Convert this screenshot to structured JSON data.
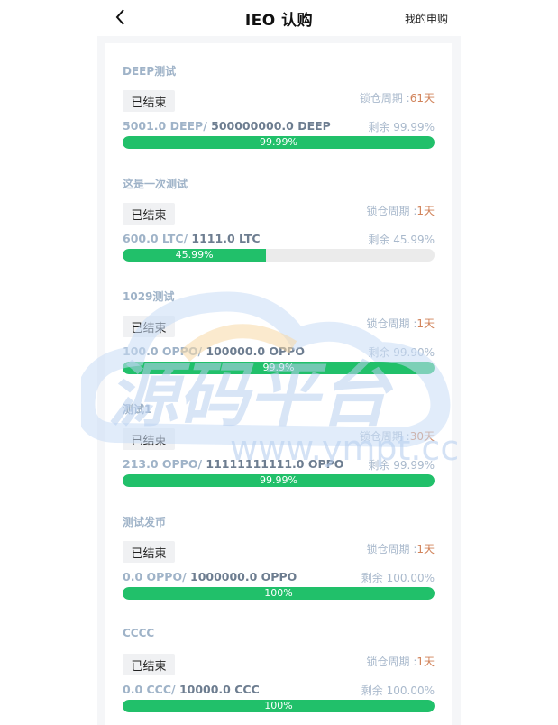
{
  "header": {
    "title": "IEO 认购",
    "my_apply": "我的申购"
  },
  "colors": {
    "progress": "#21c06a",
    "track": "#ebebeb",
    "lock_value": "#d1835a",
    "muted_text": "#9fb3c8"
  },
  "icons": {
    "back": "chevron-left-icon"
  },
  "watermark": {
    "text": "源码平台",
    "url": "www.ympt.cc"
  },
  "items": [
    {
      "name": "DEEP测试",
      "status": "已结束",
      "lock_label": "锁仓周期 :",
      "lock_value": "61天",
      "sold": "5001.0 DEEP/",
      "total": " 500000000.0 DEEP",
      "remain": "剩余 99.99%",
      "progress": 100,
      "progress_label": "99.99%"
    },
    {
      "name": "这是一次测试",
      "status": "已结束",
      "lock_label": "锁仓周期 :",
      "lock_value": "1天",
      "sold": "600.0 LTC/",
      "total": " 1111.0 LTC",
      "remain": "剩余 45.99%",
      "progress": 45.99,
      "progress_label": "45.99%"
    },
    {
      "name": "1029测试",
      "status": "已结束",
      "lock_label": "锁仓周期 :",
      "lock_value": "1天",
      "sold": "100.0 OPPO/",
      "total": " 100000.0 OPPO",
      "remain": "剩余 99.90%",
      "progress": 100,
      "progress_label": "99.9%"
    },
    {
      "name": "测试1",
      "status": "已结束",
      "lock_label": "锁仓周期 :",
      "lock_value": "30天",
      "sold": "213.0 OPPO/",
      "total": " 11111111111.0 OPPO",
      "remain": "剩余 99.99%",
      "progress": 100,
      "progress_label": "99.99%"
    },
    {
      "name": "测试发币",
      "status": "已结束",
      "lock_label": "锁仓周期 :",
      "lock_value": "1天",
      "sold": "0.0 OPPO/",
      "total": " 1000000.0 OPPO",
      "remain": "剩余 100.00%",
      "progress": 100,
      "progress_label": "100%"
    },
    {
      "name": "CCCC",
      "status": "已结束",
      "lock_label": "锁仓周期 :",
      "lock_value": "1天",
      "sold": "0.0 CCC/",
      "total": " 10000.0 CCC",
      "remain": "剩余 100.00%",
      "progress": 100,
      "progress_label": "100%"
    }
  ]
}
